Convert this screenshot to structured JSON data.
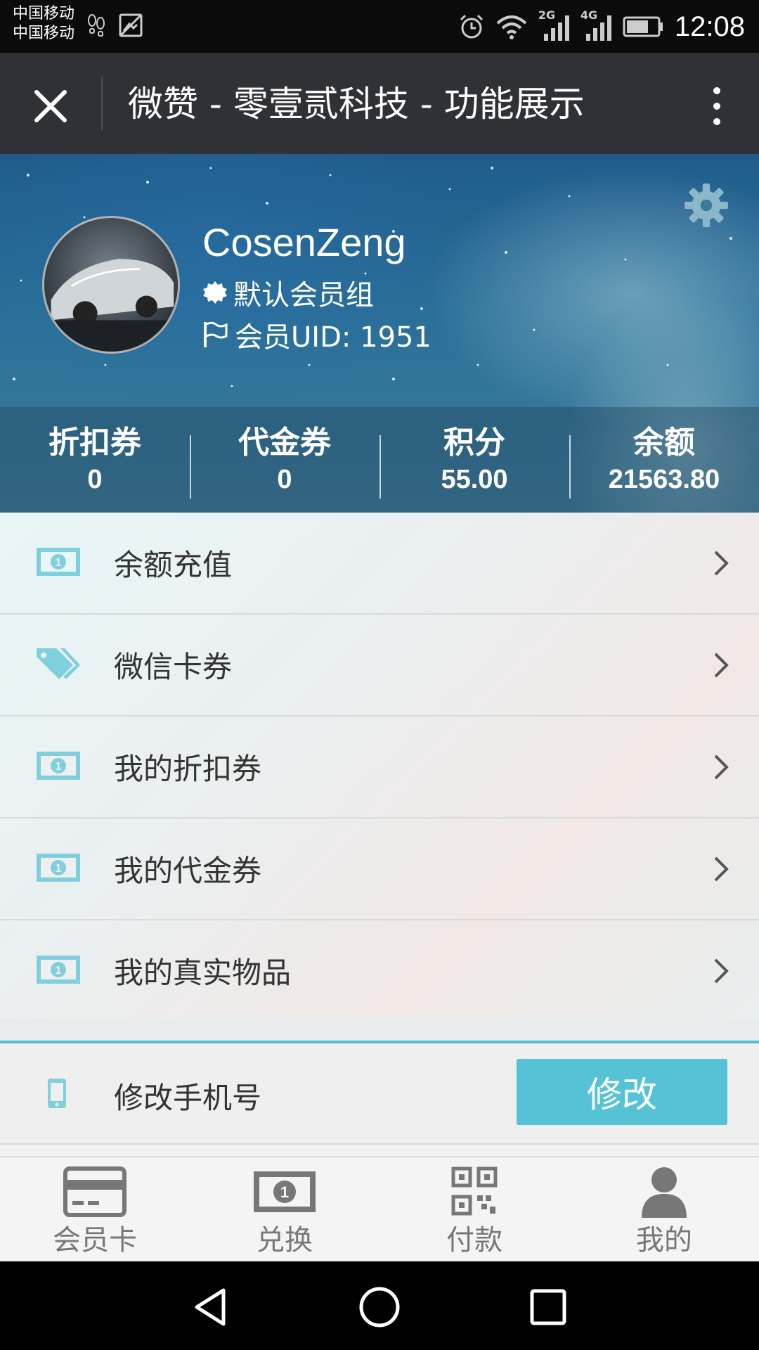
{
  "status_bar": {
    "carrier_1": "中国移动",
    "carrier_2": "中国移动",
    "net_1": "2G",
    "net_2": "4G",
    "time": "12:08"
  },
  "title_bar": {
    "title": "微赞 - 零壹贰科技 - 功能展示"
  },
  "profile": {
    "username": "CosenZeng",
    "group": "默认会员组",
    "uid": "会员UID: 1951"
  },
  "stats": [
    {
      "label": "折扣券",
      "value": "0"
    },
    {
      "label": "代金券",
      "value": "0"
    },
    {
      "label": "积分",
      "value": "55.00"
    },
    {
      "label": "余额",
      "value": "21563.80"
    }
  ],
  "menu": [
    {
      "label": "余额充值",
      "icon": "money-icon"
    },
    {
      "label": "微信卡券",
      "icon": "tag-icon"
    },
    {
      "label": "我的折扣券",
      "icon": "money-icon"
    },
    {
      "label": "我的代金券",
      "icon": "money-icon"
    },
    {
      "label": "我的真实物品",
      "icon": "money-icon"
    }
  ],
  "phone": {
    "label": "修改手机号",
    "button": "修改"
  },
  "tabs": [
    {
      "label": "会员卡",
      "icon": "card-icon"
    },
    {
      "label": "兑换",
      "icon": "money-icon"
    },
    {
      "label": "付款",
      "icon": "qrcode-icon"
    },
    {
      "label": "我的",
      "icon": "user-icon"
    }
  ],
  "colors": {
    "accent": "#55c3d5",
    "icon": "#7fcfdc",
    "title_bar": "#2f3136"
  }
}
